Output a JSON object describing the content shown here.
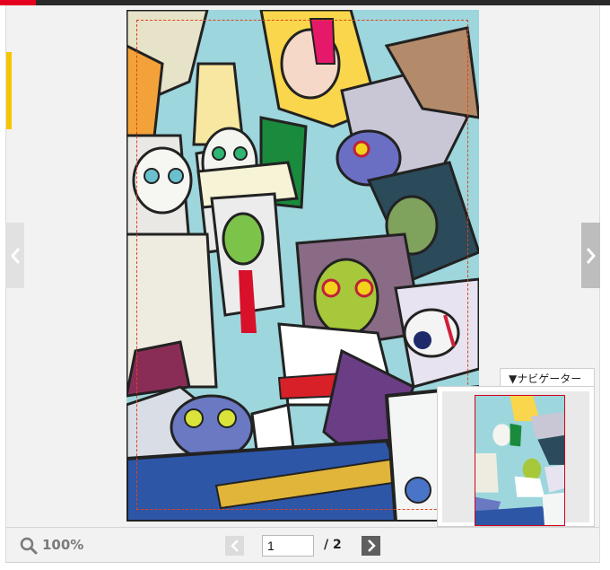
{
  "navigator": {
    "title": "▼ナビゲーター"
  },
  "toolbar": {
    "zoom_label": "100%",
    "current_page": "1",
    "total_pages": "/ 2"
  },
  "colors": {
    "accent": "#e6001f",
    "side_tab": "#f7c500",
    "view_rect": "#e0421b"
  },
  "icons": {
    "zoom": "magnifier-icon",
    "prev": "chevron-left-icon",
    "next": "chevron-right-icon"
  }
}
